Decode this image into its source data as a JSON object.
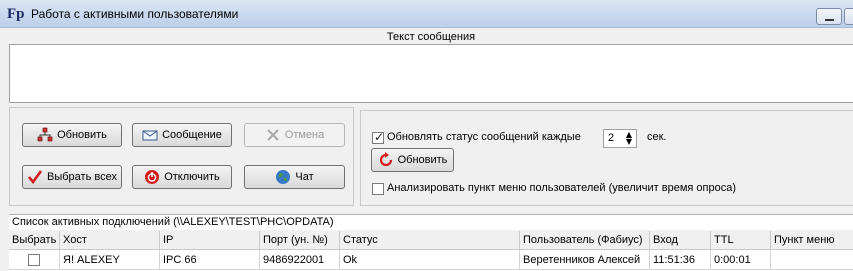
{
  "window": {
    "title": "Работа с активными пользователями",
    "app_icon_text": "Fp"
  },
  "message": {
    "header": "Текст сообщения",
    "value": ""
  },
  "buttons": {
    "refresh": "Обновить",
    "message": "Сообщение",
    "cancel": "Отмена",
    "select_all": "Выбрать всех",
    "disconnect": "Отключить",
    "chat": "Чат"
  },
  "options": {
    "auto_refresh_label": "Обновлять статус сообщений каждые",
    "auto_refresh_checked": true,
    "interval_value": "2",
    "interval_unit": "сек.",
    "refresh_button": "Обновить",
    "analyze_label": "Анализировать пункт меню пользователей (увеличит время опроса)",
    "analyze_checked": false
  },
  "connections": {
    "header": "Список активных подключений (\\\\ALEXEY\\TEST\\PHC\\OPDATA)",
    "columns": [
      "Выбрать",
      "Хост",
      "IP",
      "Порт (ун. №)",
      "Статус",
      "Пользователь (Фабиус)",
      "Вход",
      "TTL",
      "Пункт меню"
    ],
    "rows": [
      {
        "selected": false,
        "host": "Я! ALEXEY",
        "ip": "IPC 66",
        "port": "9486922001",
        "status": "Ok",
        "user": "Веретенников Алексей",
        "login": "11:51:36",
        "ttl": "0:00:01",
        "menu_item": ""
      }
    ]
  },
  "icons": {
    "refresh": "network-refresh-icon",
    "message": "envelope-icon",
    "cancel": "cancel-x-icon",
    "select_all": "red-checkmark-icon",
    "disconnect": "power-off-icon",
    "chat": "globe-icon",
    "refresh2": "red-refresh-arrow-icon"
  },
  "colors": {
    "titlebar": "#c9d9ee",
    "window_bg": "#f0f0f0",
    "accent_red": "#d21e1e"
  }
}
